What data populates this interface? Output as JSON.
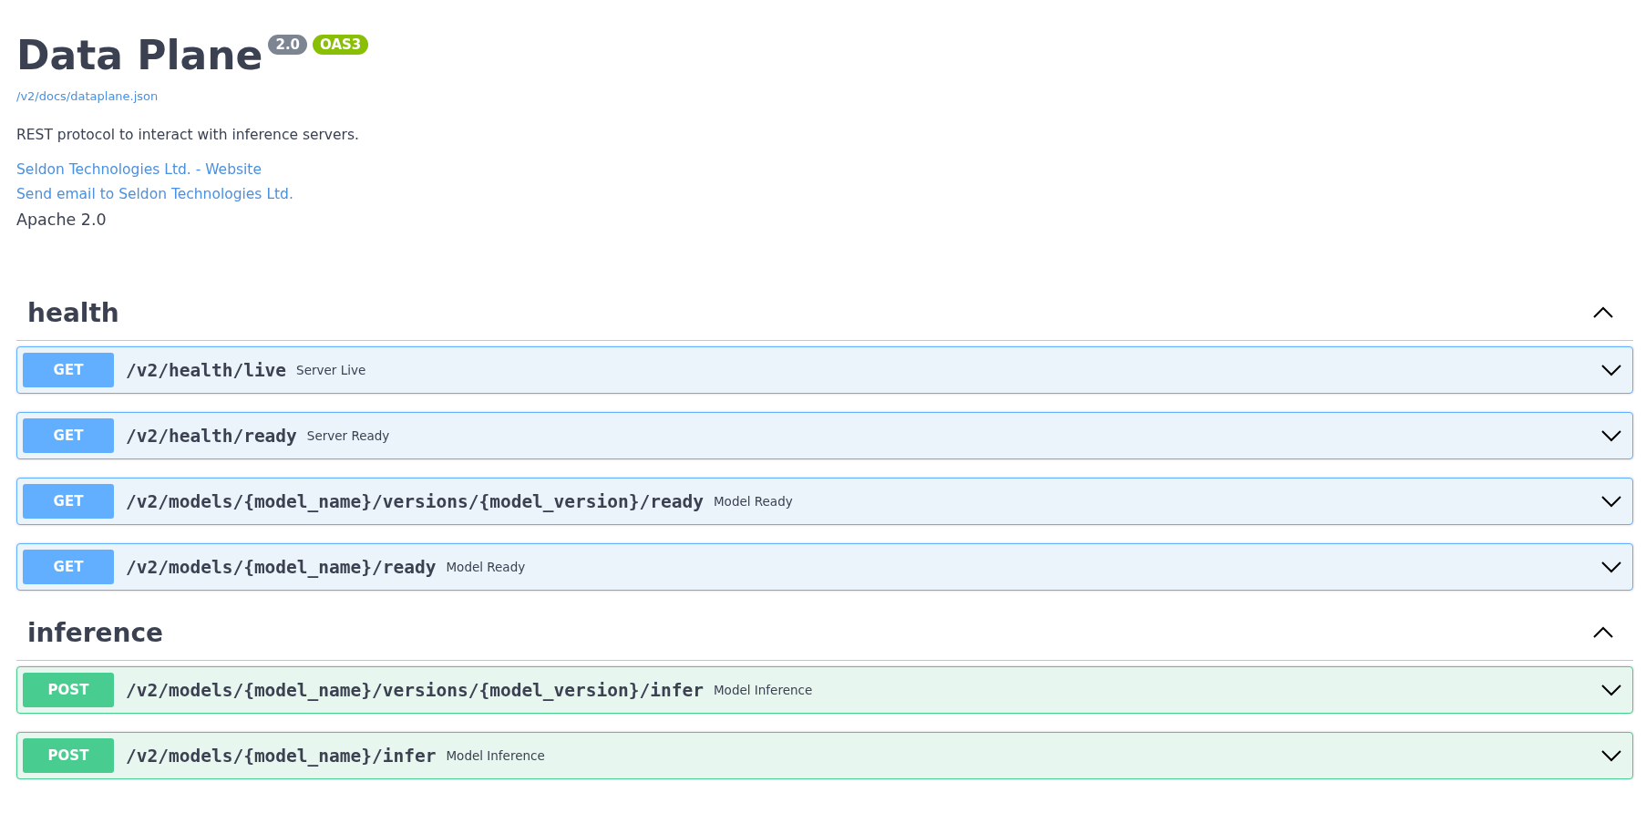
{
  "info": {
    "title": "Data Plane",
    "version": "2.0",
    "oas_badge": "OAS3",
    "spec_url": "/v2/docs/dataplane.json",
    "description": "REST protocol to interact with inference servers.",
    "links": [
      "Seldon Technologies Ltd. - Website",
      "Send email to Seldon Technologies Ltd."
    ],
    "license": "Apache 2.0"
  },
  "tags": [
    {
      "name": "health",
      "expanded": true,
      "operations": [
        {
          "method": "GET",
          "kind": "get",
          "path": "/v2/health/live",
          "summary": "Server Live",
          "expanded": false
        },
        {
          "method": "GET",
          "kind": "get",
          "path": "/v2/health/ready",
          "summary": "Server Ready",
          "expanded": false
        },
        {
          "method": "GET",
          "kind": "get",
          "path": "/v2/models/{model_name}/versions/{model_version}/ready",
          "summary": "Model Ready",
          "expanded": false
        },
        {
          "method": "GET",
          "kind": "get",
          "path": "/v2/models/{model_name}/ready",
          "summary": "Model Ready",
          "expanded": false
        }
      ]
    },
    {
      "name": "inference",
      "expanded": true,
      "operations": [
        {
          "method": "POST",
          "kind": "post",
          "path": "/v2/models/{model_name}/versions/{model_version}/infer",
          "summary": "Model Inference",
          "expanded": false
        },
        {
          "method": "POST",
          "kind": "post",
          "path": "/v2/models/{model_name}/infer",
          "summary": "Model Inference",
          "expanded": false
        }
      ]
    }
  ]
}
